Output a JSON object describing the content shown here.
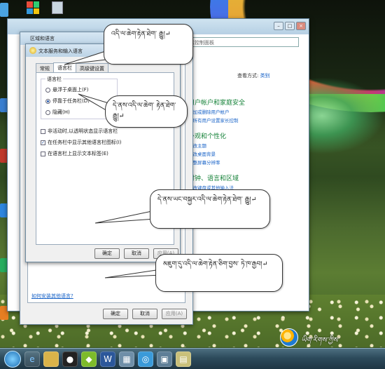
{
  "control_panel": {
    "search_placeholder": "搜索控制面板",
    "view_by_label": "查看方式:",
    "view_by_value": "类别",
    "sections": [
      {
        "heading": "用户帐户和家庭安全",
        "links": [
          "添加或删除用户帐户",
          "为所有用户设置家长控制"
        ]
      },
      {
        "heading": "外观和个性化",
        "links": [
          "更改主题",
          "更改桌面背景",
          "调整屏幕分辨率"
        ]
      },
      {
        "heading": "时钟、语言和区域",
        "links": [
          "更改键盘或其他输入法"
        ]
      }
    ]
  },
  "region_dialog": {
    "title": "区域和语言",
    "link": "如何安装其他语言?",
    "ok": "确定",
    "cancel": "取消",
    "apply": "应用(A)"
  },
  "text_services": {
    "title": "文本服务和输入语言",
    "tabs": [
      "常规",
      "语言栏",
      "高级键设置"
    ],
    "active_tab": 1,
    "group_title": "语言栏",
    "options": [
      {
        "label": "悬浮于桌面上(F)",
        "selected": false
      },
      {
        "label": "停靠于任务栏(D)",
        "selected": true
      },
      {
        "label": "隐藏(H)",
        "selected": false
      }
    ],
    "checkboxes": [
      {
        "label": "非活动时,以透明状态显示语言栏",
        "checked": false
      },
      {
        "label": "在任务栏中显示其他语言栏图标(I)",
        "checked": true
      },
      {
        "label": "在语言栏上显示文本标签(E)",
        "checked": false
      }
    ],
    "ok": "确定",
    "cancel": "取消",
    "apply": "应用(A)"
  },
  "callouts": [
    {
      "text": "འདི་ལ་ཆེག་རྟེན་ཐེག་ རྒྱུ།↵"
    },
    {
      "text": "དེ་ནས་འདི་ལ་ཆེག་ རྟེན་ཐེག་རྒྱུ།↵"
    },
    {
      "text": "དེ་ནས་ཡང་བསྐྱར་འདི་ལ་ཆེག་རྟེན་ཐེག་ རྒྱུ།↵"
    },
    {
      "text": "མཇུག་དུ་འདི་ལ་ཆེག་རྟེན་ཅིག་བྱས་ ཏེ་ཁ་རྒྱབ།↵"
    }
  ],
  "logo_text": "ཡིག་རིགས་ཀྱིས་",
  "colors": {
    "link": "#1a64c8",
    "heading_green": "#17833a",
    "taskbar": "#2d4b5c"
  }
}
